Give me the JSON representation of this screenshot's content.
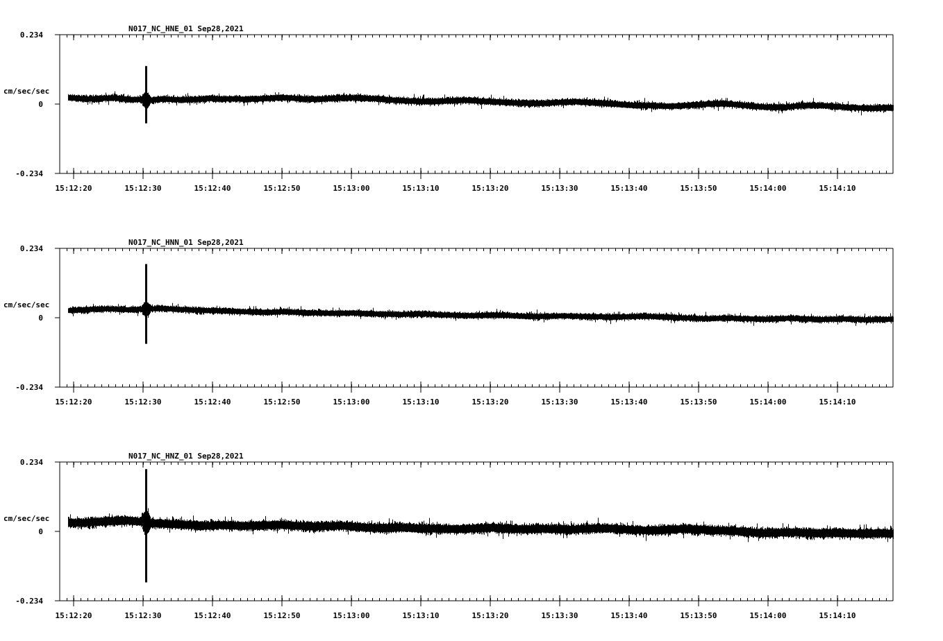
{
  "chart_data": [
    {
      "type": "line",
      "title": "N017_NC_HNE_01   Sep28,2021",
      "ylabel": "cm/sec/sec",
      "xlabel": "",
      "ylim": [
        -0.234,
        0.234
      ],
      "y_ticks": [
        "0.234",
        "0",
        "-0.234"
      ],
      "x_ticks": [
        "15:12:20",
        "15:12:30",
        "15:12:40",
        "15:12:50",
        "15:13:00",
        "15:13:10",
        "15:13:20",
        "15:13:30",
        "15:13:40",
        "15:13:50",
        "15:14:00",
        "15:14:10"
      ],
      "series": [
        {
          "values": [
            0.022,
            0.018,
            0.017,
            0.02,
            0.021,
            0.016,
            0.015,
            0.013,
            0.017,
            0.015,
            0.014,
            0.016,
            0.019,
            0.017,
            0.018,
            0.016,
            0.017,
            0.019,
            0.022,
            0.02,
            0.017,
            0.016,
            0.018,
            0.02,
            0.021,
            0.02,
            0.018,
            0.015,
            0.012,
            0.01,
            0.009,
            0.008,
            0.011,
            0.012,
            0.013,
            0.01,
            0.008,
            0.006,
            0.004,
            0.003,
            0.002,
            0.004,
            0.006,
            0.008,
            0.006,
            0.004,
            0.001,
            -0.002,
            -0.004,
            -0.005,
            -0.006,
            -0.008,
            -0.006,
            -0.003,
            -0.001,
            0.002,
            0.001,
            -0.003,
            -0.007,
            -0.01,
            -0.012,
            -0.01,
            -0.006,
            -0.004,
            -0.005,
            -0.008,
            -0.011,
            -0.013,
            -0.014,
            -0.013,
            -0.012
          ],
          "noise": 0.014,
          "spike": {
            "time": "15:12:30.4",
            "max": 0.128,
            "min": -0.065
          }
        }
      ]
    },
    {
      "type": "line",
      "title": "N017_NC_HNN_01   Sep28,2021",
      "ylabel": "cm/sec/sec",
      "xlabel": "",
      "ylim": [
        -0.234,
        0.234
      ],
      "y_ticks": [
        "0.234",
        "0",
        "-0.234"
      ],
      "x_ticks": [
        "15:12:20",
        "15:12:30",
        "15:12:40",
        "15:12:50",
        "15:13:00",
        "15:13:10",
        "15:13:20",
        "15:13:30",
        "15:13:40",
        "15:13:50",
        "15:14:00",
        "15:14:10"
      ],
      "series": [
        {
          "values": [
            0.024,
            0.026,
            0.028,
            0.03,
            0.029,
            0.027,
            0.028,
            0.03,
            0.031,
            0.029,
            0.027,
            0.025,
            0.024,
            0.023,
            0.022,
            0.02,
            0.019,
            0.018,
            0.02,
            0.019,
            0.017,
            0.016,
            0.015,
            0.015,
            0.016,
            0.014,
            0.013,
            0.012,
            0.011,
            0.012,
            0.013,
            0.011,
            0.009,
            0.008,
            0.007,
            0.008,
            0.009,
            0.008,
            0.006,
            0.005,
            0.004,
            0.005,
            0.006,
            0.005,
            0.004,
            0.003,
            0.002,
            0.003,
            0.004,
            0.005,
            0.003,
            0.001,
            0.0,
            -0.002,
            -0.003,
            -0.002,
            -0.001,
            -0.003,
            -0.004,
            -0.005,
            -0.004,
            -0.002,
            -0.003,
            -0.005,
            -0.006,
            -0.005,
            -0.004,
            -0.006,
            -0.007,
            -0.006,
            -0.005
          ],
          "noise": 0.013,
          "spike": {
            "time": "15:12:30.4",
            "max": 0.181,
            "min": -0.088
          }
        }
      ]
    },
    {
      "type": "line",
      "title": "N017_NC_HNZ_01   Sep28,2021",
      "ylabel": "cm/sec/sec",
      "xlabel": "",
      "ylim": [
        -0.234,
        0.234
      ],
      "y_ticks": [
        "0.234",
        "0",
        "-0.234"
      ],
      "x_ticks": [
        "15:12:20",
        "15:12:30",
        "15:12:40",
        "15:12:50",
        "15:13:00",
        "15:13:10",
        "15:13:20",
        "15:13:30",
        "15:13:40",
        "15:13:50",
        "15:14:00",
        "15:14:10"
      ],
      "series": [
        {
          "values": [
            0.03,
            0.028,
            0.031,
            0.033,
            0.035,
            0.037,
            0.033,
            0.028,
            0.026,
            0.024,
            0.022,
            0.02,
            0.019,
            0.021,
            0.02,
            0.018,
            0.019,
            0.021,
            0.022,
            0.02,
            0.018,
            0.016,
            0.018,
            0.019,
            0.017,
            0.014,
            0.012,
            0.011,
            0.013,
            0.012,
            0.01,
            0.009,
            0.008,
            0.007,
            0.009,
            0.011,
            0.012,
            0.01,
            0.008,
            0.007,
            0.009,
            0.008,
            0.006,
            0.007,
            0.009,
            0.011,
            0.01,
            0.007,
            0.005,
            0.003,
            0.004,
            0.006,
            0.008,
            0.007,
            0.005,
            0.003,
            0.002,
            0.0,
            -0.003,
            -0.006,
            -0.005,
            -0.003,
            -0.004,
            -0.006,
            -0.007,
            -0.005,
            -0.006,
            -0.008,
            -0.007,
            -0.006,
            -0.008
          ],
          "noise": 0.02,
          "spike": {
            "time": "15:12:30.4",
            "max": 0.21,
            "min": -0.172
          }
        }
      ]
    }
  ]
}
